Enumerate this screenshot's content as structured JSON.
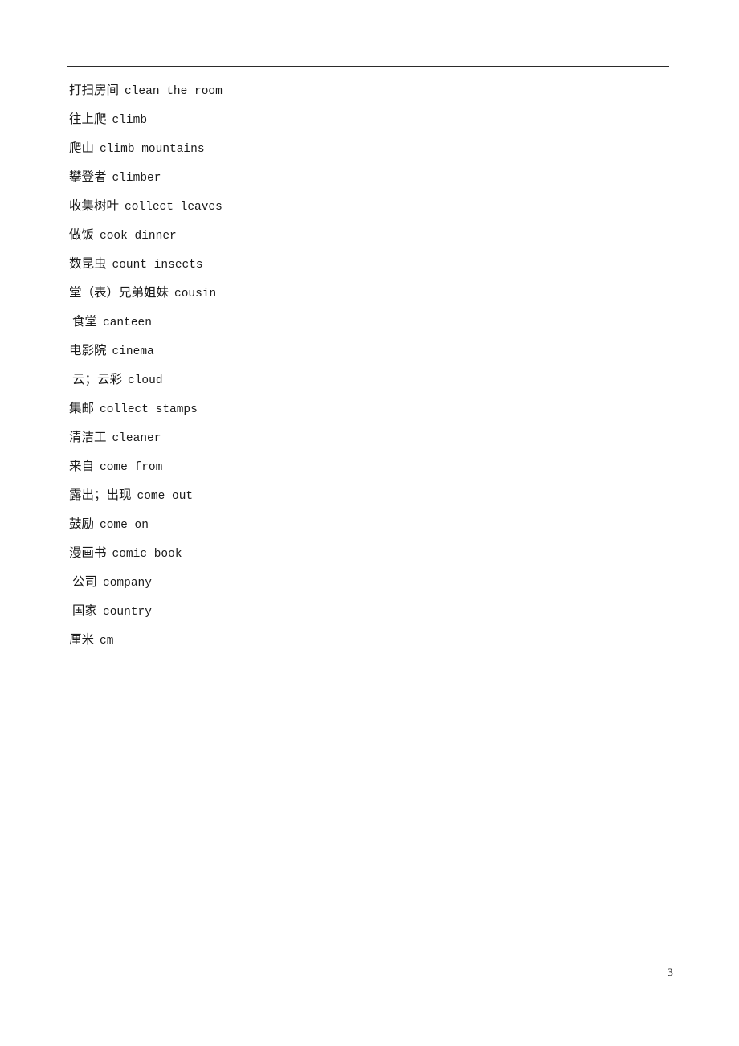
{
  "document": {
    "page_number": "3",
    "has_header_rule": true,
    "entries": [
      {
        "zh": "打扫房间",
        "en": "clean the room",
        "indent": false
      },
      {
        "zh": "往上爬",
        "en": "climb",
        "indent": false
      },
      {
        "zh": "爬山",
        "en": "climb mountains",
        "indent": false
      },
      {
        "zh": "攀登者",
        "en": "climber",
        "indent": false
      },
      {
        "zh": "收集树叶",
        "en": "collect leaves",
        "indent": false
      },
      {
        "zh": "做饭",
        "en": "cook dinner",
        "indent": false
      },
      {
        "zh": "数昆虫",
        "en": "count insects",
        "indent": false
      },
      {
        "zh": "堂（表）兄弟姐妹",
        "en": "cousin",
        "indent": false
      },
      {
        "zh": "食堂",
        "en": "canteen",
        "indent": true
      },
      {
        "zh": "电影院",
        "en": "cinema",
        "indent": false
      },
      {
        "zh": "云；云彩",
        "en": "cloud",
        "indent": true
      },
      {
        "zh": "集邮",
        "en": "collect stamps",
        "indent": false
      },
      {
        "zh": "清洁工",
        "en": "cleaner",
        "indent": false
      },
      {
        "zh": "来自",
        "en": "come from",
        "indent": false
      },
      {
        "zh": "露出；出现",
        "en": "come out",
        "indent": false
      },
      {
        "zh": "鼓励",
        "en": "come on",
        "indent": false
      },
      {
        "zh": "漫画书",
        "en": "comic book",
        "indent": false
      },
      {
        "zh": "公司",
        "en": "company",
        "indent": true
      },
      {
        "zh": "国家",
        "en": "country",
        "indent": true
      },
      {
        "zh": "厘米",
        "en": "cm",
        "indent": false
      }
    ]
  }
}
